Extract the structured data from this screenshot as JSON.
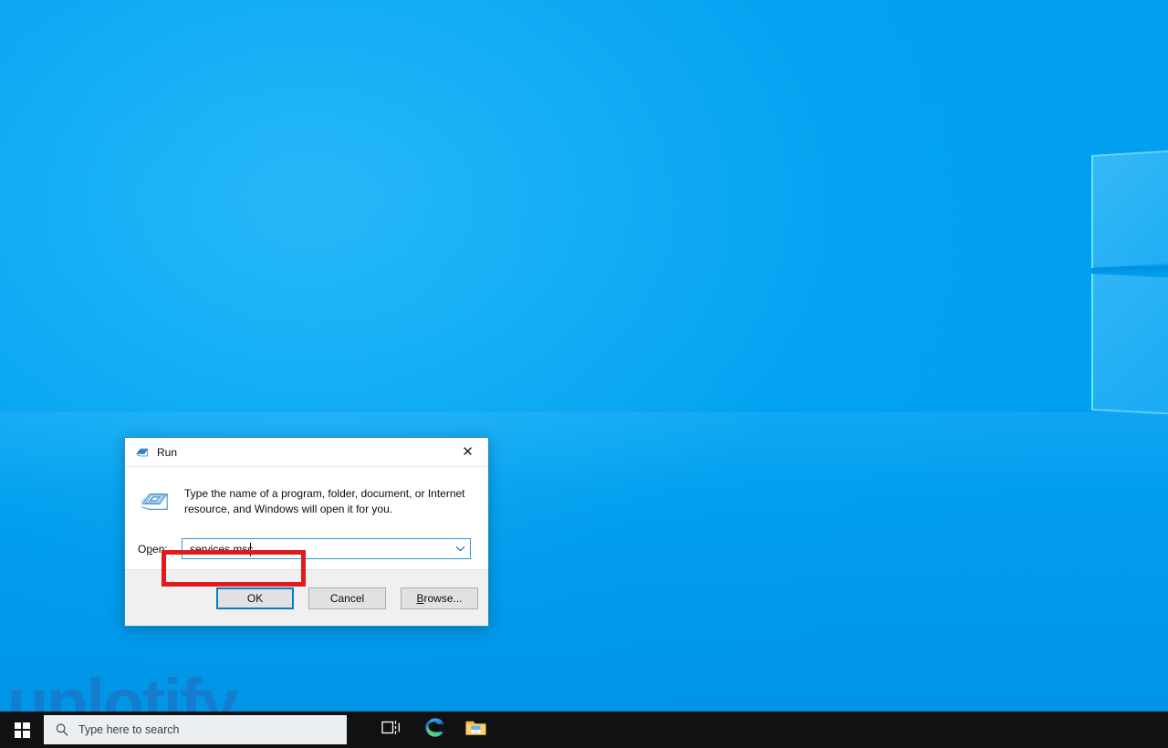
{
  "desktop": {
    "watermark": "uplotify",
    "wallpaper_color": "#02a4f2"
  },
  "taskbar": {
    "start_tooltip": "Start",
    "search_placeholder": "Type here to search",
    "items": [
      {
        "name": "task-view",
        "label": "Task View"
      },
      {
        "name": "microsoft-edge",
        "label": "Microsoft Edge"
      },
      {
        "name": "file-explorer",
        "label": "File Explorer"
      }
    ]
  },
  "run_dialog": {
    "title": "Run",
    "close_label": "✕",
    "description": "Type the name of a program, folder, document, or Internet resource, and Windows will open it for you.",
    "open_label_prefix": "O",
    "open_label_underline": "p",
    "open_label_suffix": "en:",
    "input_value": "services.msc",
    "input_placeholder": "",
    "buttons": {
      "ok": "OK",
      "cancel": "Cancel",
      "browse_prefix": "",
      "browse_underline": "B",
      "browse_suffix": "rowse..."
    },
    "highlight_color": "#e01b1b",
    "focus_color": "#0a7dc4"
  }
}
